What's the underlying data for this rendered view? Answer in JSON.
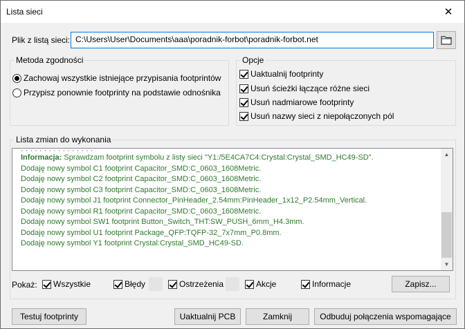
{
  "window": {
    "title": "Lista sieci"
  },
  "file": {
    "label": "Plik z listą sieci:",
    "value": "C:\\Users\\User\\Documents\\aaa\\poradnik-forbot\\poradnik-forbot.net"
  },
  "match_method": {
    "legend": "Metoda zgodności",
    "options": [
      {
        "label": "Zachowaj wszystkie istniejące przypisania footprintów",
        "selected": true
      },
      {
        "label": "Przypisz ponownie footprinty na podstawie odnośnika",
        "selected": false
      }
    ]
  },
  "options": {
    "legend": "Opcje",
    "items": [
      {
        "label": "Uaktualnij footprinty",
        "checked": true
      },
      {
        "label": "Usuń ścieżki łączące różne sieci",
        "checked": true
      },
      {
        "label": "Usuń nadmiarowe footprinty",
        "checked": true
      },
      {
        "label": "Usuń nazwy sieci z niepołączonych pól",
        "checked": true
      }
    ]
  },
  "changes": {
    "legend": "Lista zmian do wykonania",
    "lines": [
      {
        "tag": "Informacja:",
        "text": " Sprawdzam footprint symbolu z listy sieci \"Y1:/5E4CA7C4:Crystal:Crystal_SMD_HC49-SD\"."
      },
      {
        "text": "Dodaję nowy symbol C1 footprint Capacitor_SMD:C_0603_1608Metric."
      },
      {
        "text": "Dodaję nowy symbol C2 footprint Capacitor_SMD:C_0603_1608Metric."
      },
      {
        "text": "Dodaję nowy symbol C3 footprint Capacitor_SMD:C_0603_1608Metric."
      },
      {
        "text": "Dodaję nowy symbol J1 footprint Connector_PinHeader_2.54mm:PinHeader_1x12_P2.54mm_Vertical."
      },
      {
        "text": "Dodaję nowy symbol R1 footprint Capacitor_SMD:C_0603_1608Metric."
      },
      {
        "text": "Dodaję nowy symbol SW1 footprint Button_Switch_THT:SW_PUSH_6mm_H4.3mm."
      },
      {
        "text": "Dodaję nowy symbol U1 footprint Package_QFP:TQFP-32_7x7mm_P0.8mm."
      },
      {
        "text": "Dodaję nowy symbol Y1 footprint Crystal:Crystal_SMD_HC49-SD."
      }
    ]
  },
  "filter": {
    "label": "Pokaż:",
    "all": "Wszystkie",
    "errors": "Błędy",
    "warnings": "Ostrzeżenia",
    "actions": "Akcje",
    "info": "Informacje",
    "save": "Zapisz..."
  },
  "buttons": {
    "test": "Testuj footprinty",
    "update_pcb": "Uaktualnij PCB",
    "close": "Zamknij",
    "rebuild": "Odbuduj połączenia wspomagające"
  },
  "colors": {
    "log_text": "#2e7a2e",
    "focus_border": "#0078d7"
  }
}
